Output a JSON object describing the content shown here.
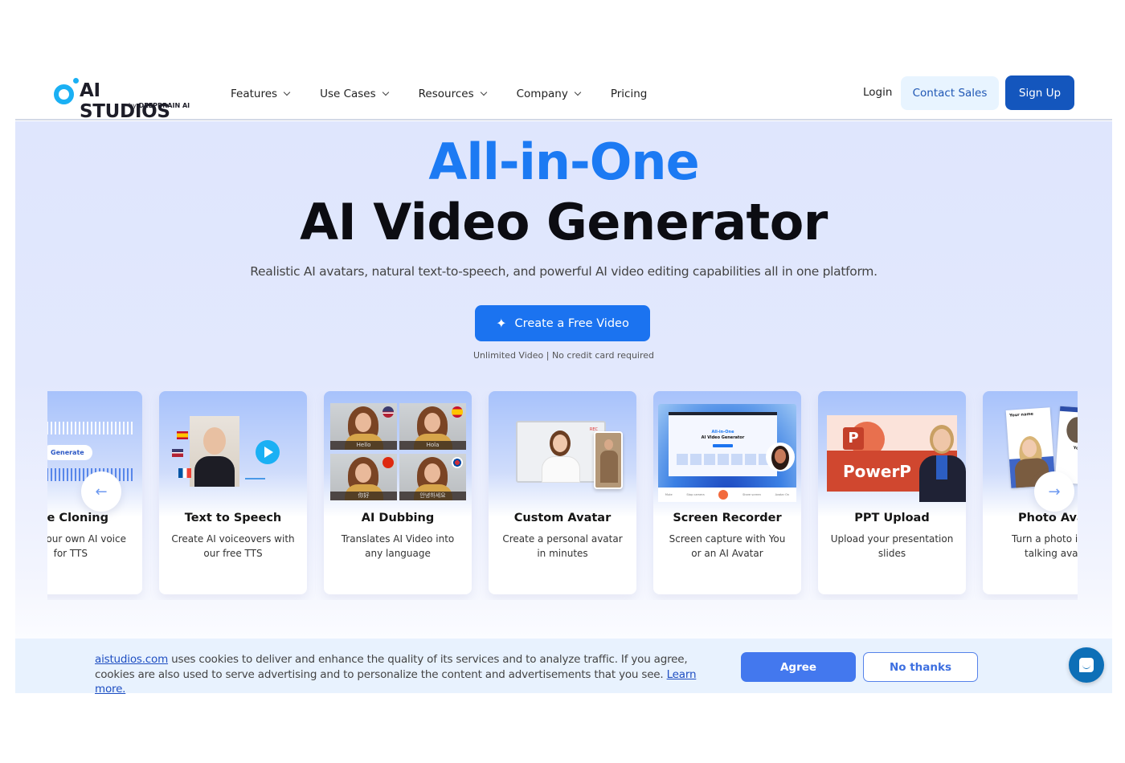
{
  "header": {
    "logo": {
      "name": "AI STUDIOS",
      "by": "by",
      "brand": "DEEPBRAIN AI"
    },
    "nav": [
      {
        "label": "Features",
        "dropdown": true
      },
      {
        "label": "Use Cases",
        "dropdown": true
      },
      {
        "label": "Resources",
        "dropdown": true
      },
      {
        "label": "Company",
        "dropdown": true
      },
      {
        "label": "Pricing",
        "dropdown": false
      }
    ],
    "login": "Login",
    "contact_sales": "Contact Sales",
    "sign_up": "Sign Up"
  },
  "hero": {
    "title_accent": "All-in-One",
    "title_main": "AI Video Generator",
    "subtitle": "Realistic AI avatars, natural text-to-speech, and powerful AI video editing capabilities all in one platform.",
    "cta_label": "Create a Free Video",
    "cta_icon": "sparkle-icon",
    "cta_note": "Unlimited Video | No credit card required"
  },
  "carousel": {
    "prev_icon": "arrow-left-icon",
    "next_icon": "arrow-right-icon",
    "cards": [
      {
        "title": "ce Cloning",
        "desc_lines": [
          "our own AI voice",
          "for TTS"
        ],
        "media": {
          "button": "Generate"
        }
      },
      {
        "title": "Text to Speech",
        "desc_lines": [
          "Create AI voiceovers with",
          "our free TTS"
        ]
      },
      {
        "title": "AI Dubbing",
        "desc_lines": [
          "Translates AI Video into",
          "any language"
        ],
        "media": {
          "captions": [
            "Hello",
            "Hola",
            "你好",
            "안녕하세요"
          ]
        }
      },
      {
        "title": "Custom Avatar",
        "desc_lines": [
          "Create a personal avatar",
          "in minutes"
        ],
        "media": {
          "rec": "REC"
        }
      },
      {
        "title": "Screen Recorder",
        "desc_lines": [
          "Screen capture with You",
          "or an AI Avatar"
        ],
        "media": {
          "toolbar": [
            "Mute",
            "Stop camera",
            "Share screen",
            "Avatar On"
          ],
          "screen_title_accent": "All-in-One",
          "screen_title": "AI Video Generator"
        }
      },
      {
        "title": "PPT Upload",
        "desc_lines": [
          "Upload your presentation",
          "slides"
        ],
        "media": {
          "slide_letter": "P",
          "slide_text": "PowerP"
        }
      },
      {
        "title": "Photo Ava",
        "desc_lines": [
          "Turn a photo i",
          "talking avat"
        ],
        "media": {
          "card_label": "Your name",
          "card_label_2": "Your"
        }
      }
    ]
  },
  "cookie_banner": {
    "site_link": "aistudios.com",
    "text": " uses cookies to deliver and enhance the quality of its services and to analyze traffic. If you agree, cookies are also used to serve advertising and to personalize the content and advertisements that you see. ",
    "learn_more": "Learn more.",
    "agree": "Agree",
    "no_thanks": "No thanks"
  },
  "chat": {
    "icon": "chat-bubble-icon"
  },
  "colors": {
    "accent": "#1c7af3",
    "primary_dark": "#1456bd",
    "logo": "#1ab0f4",
    "cookie_agree": "#4378ee",
    "chat": "#0d6fb7"
  }
}
